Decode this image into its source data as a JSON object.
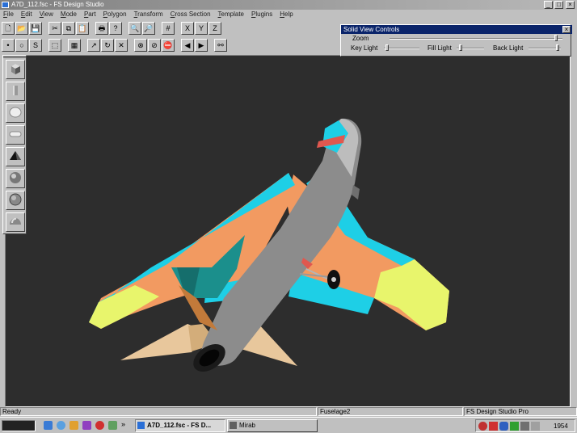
{
  "window": {
    "title": "A7D_112.fsc - FS Design Studio"
  },
  "menu": [
    "File",
    "Edit",
    "View",
    "Mode",
    "Part",
    "Polygon",
    "Transform",
    "Cross Section",
    "Template",
    "Plugins",
    "Help"
  ],
  "toolbar1": [
    {
      "name": "new-file-icon",
      "glyph": "🗋"
    },
    {
      "name": "open-folder-icon",
      "glyph": "📂"
    },
    {
      "name": "save-icon",
      "glyph": "💾"
    },
    {
      "sep": true
    },
    {
      "name": "cut-icon",
      "glyph": "✂"
    },
    {
      "name": "copy-icon",
      "glyph": "⧉"
    },
    {
      "name": "paste-icon",
      "glyph": "📋"
    },
    {
      "sep": true
    },
    {
      "name": "print-icon",
      "glyph": "🖶"
    },
    {
      "name": "help-icon",
      "glyph": "?"
    },
    {
      "sep": true
    },
    {
      "name": "zoom-in-icon",
      "glyph": "🔍"
    },
    {
      "name": "zoom-out-icon",
      "glyph": "🔎"
    },
    {
      "sep": true
    },
    {
      "name": "grid-icon",
      "glyph": "#"
    },
    {
      "sep": true
    },
    {
      "name": "axis-x-icon",
      "glyph": "X"
    },
    {
      "name": "axis-y-icon",
      "glyph": "Y"
    },
    {
      "name": "axis-z-icon",
      "glyph": "Z"
    }
  ],
  "toolbar2": [
    {
      "name": "point-mode-icon",
      "glyph": "•"
    },
    {
      "name": "circle-mode-icon",
      "glyph": "○"
    },
    {
      "name": "curve-mode-icon",
      "glyph": "S"
    },
    {
      "sep": true
    },
    {
      "name": "select-box-icon",
      "glyph": "⬚"
    },
    {
      "sep": true
    },
    {
      "name": "render-mode-icon",
      "glyph": "▦"
    },
    {
      "sep": true
    },
    {
      "name": "move-icon",
      "glyph": "↗"
    },
    {
      "name": "rotate-icon",
      "glyph": "↻"
    },
    {
      "name": "scale-icon",
      "glyph": "✕"
    },
    {
      "sep": true
    },
    {
      "name": "delete-icon",
      "glyph": "⊗"
    },
    {
      "name": "no-entry-icon",
      "glyph": "⊘"
    },
    {
      "name": "stop-icon",
      "glyph": "⛔"
    },
    {
      "sep": true
    },
    {
      "name": "arrow-left-icon",
      "glyph": "◀"
    },
    {
      "name": "arrow-right-icon",
      "glyph": "▶"
    },
    {
      "sep": true
    },
    {
      "name": "binoculars-icon",
      "glyph": "⚯"
    }
  ],
  "solid_view_controls": {
    "title": "Solid View Controls",
    "zoom_label": "Zoom",
    "key_light_label": "Key Light",
    "fill_light_label": "Fill Light",
    "back_light_label": "Back Light",
    "zoom_value": 0.97,
    "key_light_value": 0.05,
    "fill_light_value": 0.1,
    "back_light_value": 0.95
  },
  "palette": [
    "cube-shape-icon",
    "cylinder-shape-icon",
    "sphere-shape-icon",
    "capsule-shape-icon",
    "cone-shape-icon",
    "ball-shape-icon",
    "globe-shape-icon",
    "dome-shape-icon"
  ],
  "statusbar": {
    "status": "Ready",
    "part": "Fuselage2",
    "product": "FS Design Studio Pro"
  },
  "taskbar": {
    "tasks": [
      {
        "label": "A7D_112.fsc - FS D..."
      },
      {
        "label": "Mirab"
      }
    ],
    "chevron": "»",
    "clock": "1954"
  },
  "colors": {
    "viewport_bg": "#2d2d2d",
    "title_active": "#0a246a",
    "fuselage": "#8c8c8c",
    "wing_orange": "#f29a61",
    "wing_cyan": "#1ecfe6",
    "wing_yellow": "#e8f56c",
    "teal": "#1b8f8c",
    "tan": "#e8c79c"
  }
}
